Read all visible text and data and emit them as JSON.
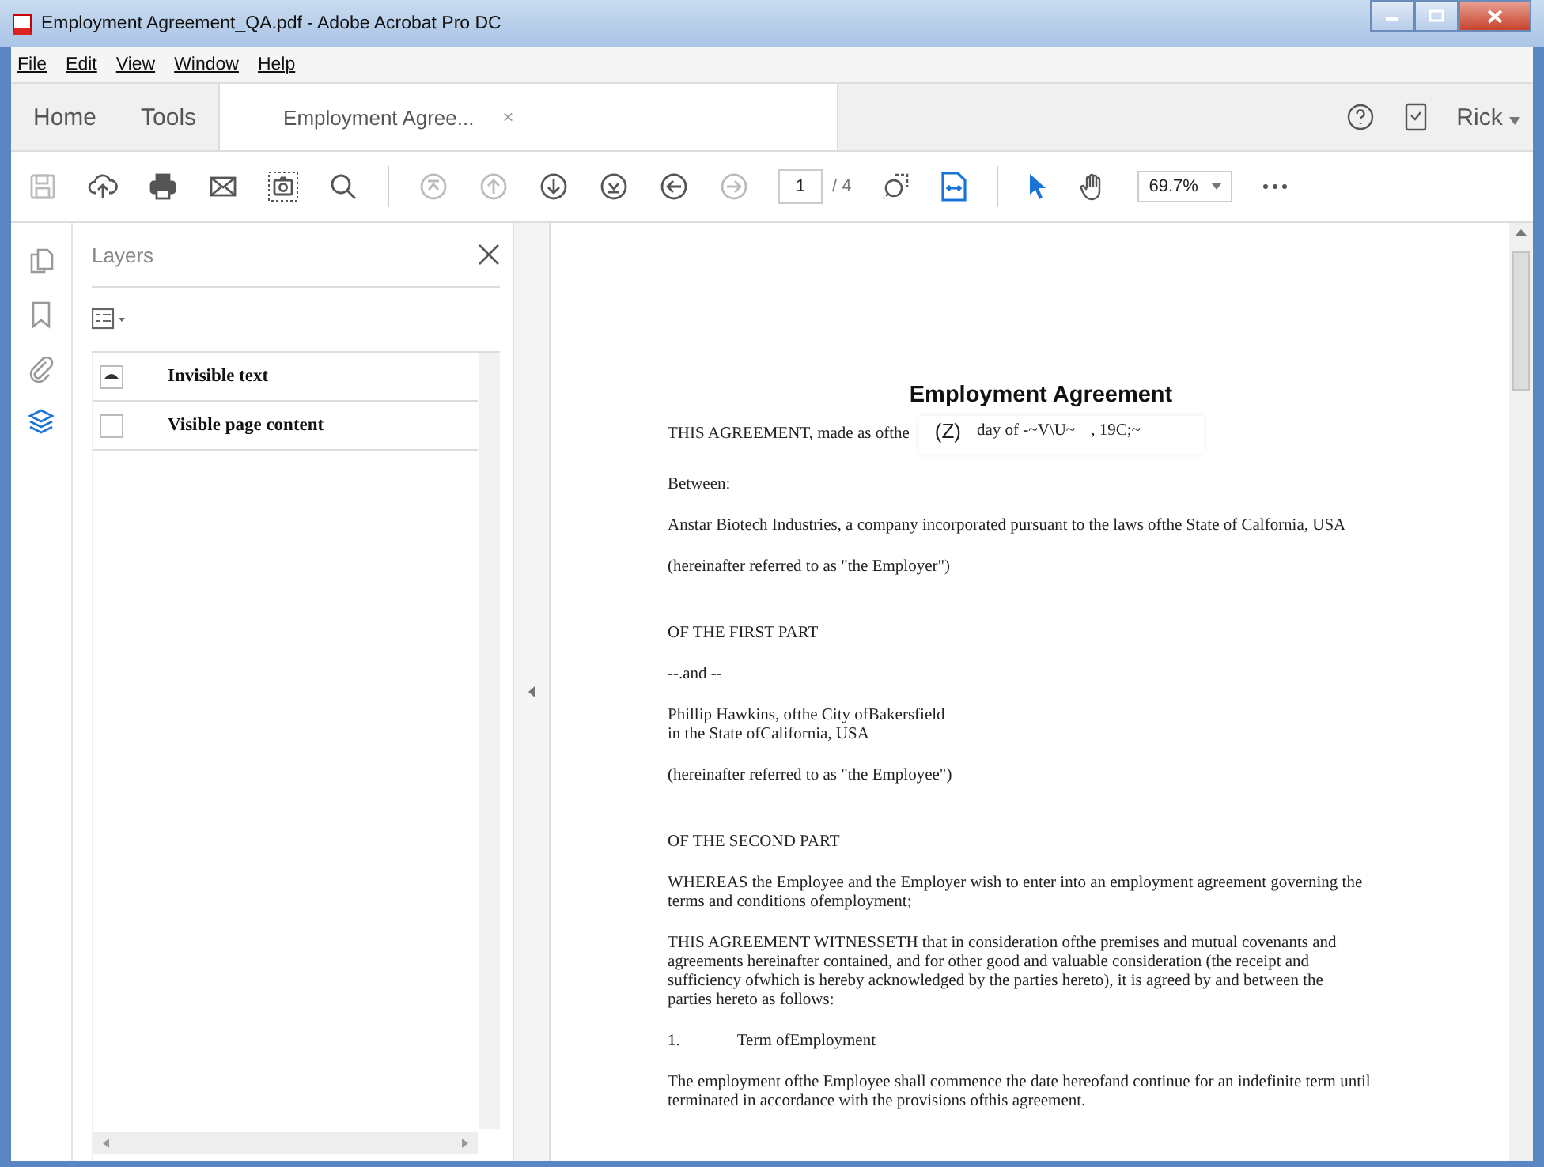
{
  "window": {
    "title": "Employment Agreement_QA.pdf - Adobe Acrobat Pro DC"
  },
  "menu": [
    "File",
    "Edit",
    "View",
    "Window",
    "Help"
  ],
  "tabs": [
    {
      "label": "Home",
      "selected": false,
      "kind": "nav"
    },
    {
      "label": "Tools",
      "selected": false,
      "kind": "nav"
    },
    {
      "label": "Employment Agree...",
      "selected": true,
      "kind": "doc",
      "close": "×"
    }
  ],
  "user": "Rick",
  "toolbar": [
    {
      "kind": "save",
      "disabled": true
    },
    {
      "kind": "upload",
      "disabled": false
    },
    {
      "kind": "print",
      "disabled": false
    },
    {
      "kind": "mail",
      "disabled": false
    },
    {
      "kind": "snapshot",
      "disabled": false
    },
    {
      "kind": "search",
      "disabled": false
    },
    {
      "kind": "sep"
    },
    {
      "kind": "first",
      "disabled": true
    },
    {
      "kind": "prev",
      "disabled": true
    },
    {
      "kind": "next",
      "disabled": false
    },
    {
      "kind": "last",
      "disabled": false
    },
    {
      "kind": "back",
      "disabled": false
    },
    {
      "kind": "forward",
      "disabled": true
    }
  ],
  "page": {
    "current": "1",
    "total": "/ 4"
  },
  "zoom": "69.7%",
  "rail": [
    {
      "kind": "pages",
      "selected": false
    },
    {
      "kind": "bookmark",
      "selected": false
    },
    {
      "kind": "attach",
      "selected": false
    },
    {
      "kind": "layers",
      "selected": true
    }
  ],
  "panel": {
    "title": "Layers",
    "layers": [
      {
        "name": "Invisible text",
        "visible": true
      },
      {
        "name": "Visible page content",
        "visible": false
      }
    ]
  },
  "document": {
    "title": "Employment Agreement",
    "date_line": {
      "text": "THIS AGREEMENT, made as ofthe",
      "fields": [
        "(Z)",
        "day of  -~V\\U~",
        ", 19C;~"
      ]
    },
    "paragraphs": [
      {
        "kind": "text",
        "text": "Between:"
      },
      {
        "kind": "text",
        "text": "Anstar Biotech Industries, a company incorporated pursuant to the laws ofthe State of Calfornia, USA"
      },
      {
        "kind": "text",
        "text": "(hereinafter referred to as \"the Employer\")"
      },
      {
        "kind": "section",
        "text": "OF THE FIRST PART"
      },
      {
        "kind": "text",
        "text": "--.and --"
      },
      {
        "kind": "lines",
        "lines": [
          "Phillip Hawkins, ofthe City ofBakersfield",
          "in the State ofCalifornia, USA"
        ]
      },
      {
        "kind": "text",
        "text": "(hereinafter referred to as \"the Employee\")"
      },
      {
        "kind": "section",
        "text": "OF THE SECOND PART"
      },
      {
        "kind": "text",
        "text": "WHEREAS the Employee and the Employer wish to enter into an employment agreement governing the terms and conditions ofemployment;"
      },
      {
        "kind": "text",
        "text": "THIS AGREEMENT WITNESSETH that in consideration ofthe premises and mutual covenants and agreements hereinafter contained, and for other good and valuable consideration (the receipt and sufficiency ofwhich is hereby acknowledged by the parties hereto), it is agreed by and between the parties hereto as follows:"
      },
      {
        "kind": "numbered",
        "number": "1.",
        "text": "Term ofEmployment"
      },
      {
        "kind": "text",
        "text": "The employment ofthe Employee shall commence the date hereofand continue for an indefinite term until terminated in accordance with the provisions ofthis agreement."
      }
    ]
  }
}
